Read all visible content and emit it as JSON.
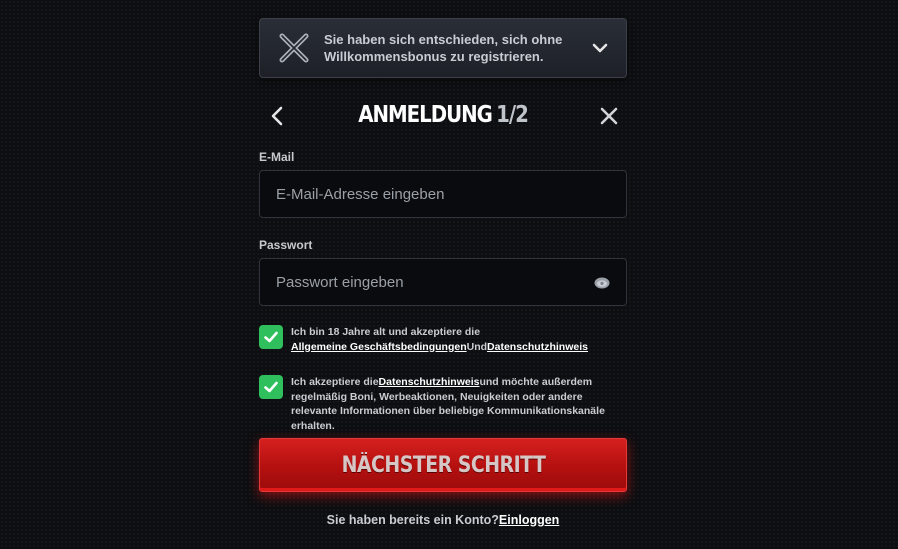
{
  "banner": {
    "text": "Sie haben sich entschieden, sich ohne Willkommensbonus zu registrieren.",
    "icon": "crossed-swords-icon",
    "toggle_icon": "chevron-down-icon"
  },
  "header": {
    "title": "ANMELDUNG",
    "step": "1/2",
    "back_icon": "chevron-left-icon",
    "close_icon": "close-icon"
  },
  "email": {
    "label": "E-Mail",
    "placeholder": "E-Mail-Adresse eingeben",
    "value": ""
  },
  "password": {
    "label": "Passwort",
    "placeholder": "Passwort eingeben",
    "value": "",
    "toggle_icon": "eye-icon"
  },
  "consent_terms": {
    "checked": true,
    "text_before": "Ich bin 18 Jahre alt und akzeptiere die",
    "link_terms": "Allgemeine Geschäftsbedingungen",
    "conjunction": "Und",
    "link_privacy": "Datenschutzhinweis"
  },
  "consent_marketing": {
    "checked": true,
    "text_before": "Ich akzeptiere die",
    "link_privacy": "Datenschutzhinweis",
    "text_after": "und möchte außerdem regelmäßig Boni, Werbeaktionen, Neuigkeiten oder andere relevante Informationen über beliebige Kommunikationskanäle erhalten."
  },
  "next_button": {
    "label": "NÄCHSTER SCHRITT"
  },
  "login": {
    "text": "Sie haben bereits ein Konto?",
    "link": "Einloggen"
  },
  "colors": {
    "accent_red": "#c41414",
    "check_green": "#2fbf5c",
    "background": "#0d0e11"
  }
}
